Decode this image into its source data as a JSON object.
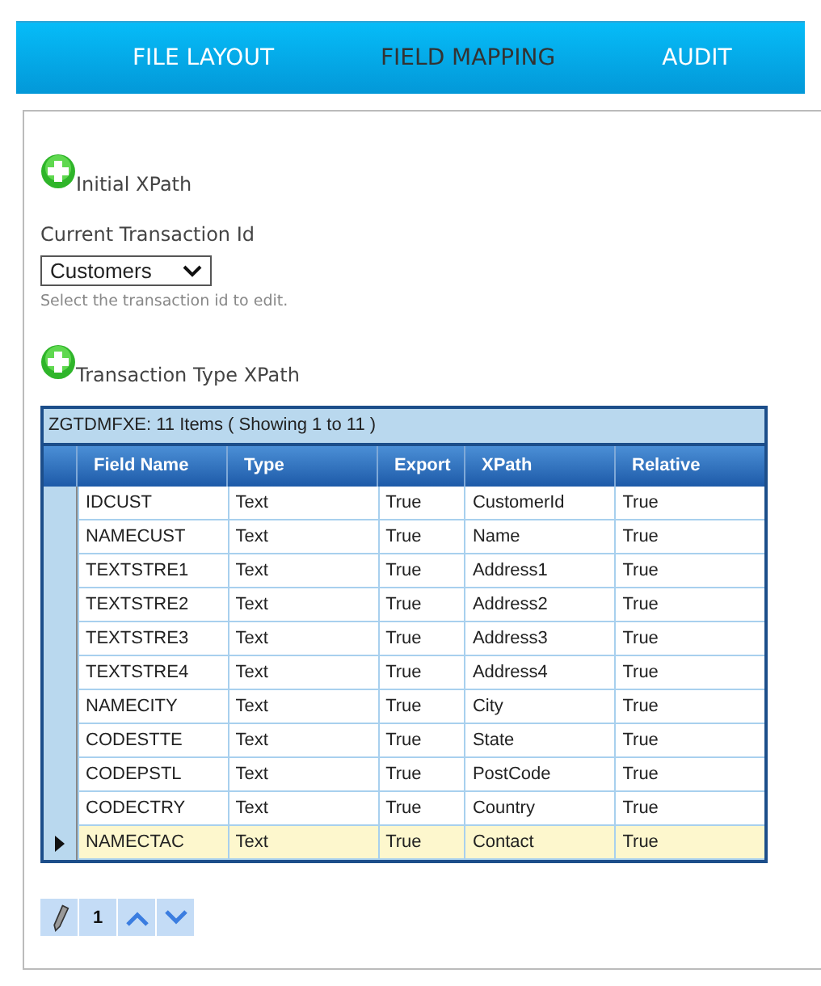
{
  "tabs": [
    {
      "label": "FILE LAYOUT",
      "selected": false
    },
    {
      "label": "FIELD MAPPING",
      "selected": true
    },
    {
      "label": "AUDIT",
      "selected": false
    }
  ],
  "initial_xpath": {
    "label": "Initial XPath"
  },
  "transaction": {
    "label": "Current Transaction Id",
    "value": "Customers",
    "hint": "Select the transaction id to edit."
  },
  "transaction_type_xpath": {
    "label": "Transaction Type XPath"
  },
  "grid": {
    "caption": "ZGTDMFXE: 11 Items ( Showing 1 to 11 )",
    "columns": [
      "Field Name",
      "Type",
      "Export",
      "XPath",
      "Relative"
    ],
    "rows": [
      {
        "cells": [
          "IDCUST",
          "Text",
          "True",
          "CustomerId",
          "True"
        ],
        "selected": false
      },
      {
        "cells": [
          "NAMECUST",
          "Text",
          "True",
          "Name",
          "True"
        ],
        "selected": false
      },
      {
        "cells": [
          "TEXTSTRE1",
          "Text",
          "True",
          "Address1",
          "True"
        ],
        "selected": false
      },
      {
        "cells": [
          "TEXTSTRE2",
          "Text",
          "True",
          "Address2",
          "True"
        ],
        "selected": false
      },
      {
        "cells": [
          "TEXTSTRE3",
          "Text",
          "True",
          "Address3",
          "True"
        ],
        "selected": false
      },
      {
        "cells": [
          "TEXTSTRE4",
          "Text",
          "True",
          "Address4",
          "True"
        ],
        "selected": false
      },
      {
        "cells": [
          "NAMECITY",
          "Text",
          "True",
          "City",
          "True"
        ],
        "selected": false
      },
      {
        "cells": [
          "CODESTTE",
          "Text",
          "True",
          "State",
          "True"
        ],
        "selected": false
      },
      {
        "cells": [
          "CODEPSTL",
          "Text",
          "True",
          "PostCode",
          "True"
        ],
        "selected": false
      },
      {
        "cells": [
          "CODECTRY",
          "Text",
          "True",
          "Country",
          "True"
        ],
        "selected": false
      },
      {
        "cells": [
          "NAMECTAC",
          "Text",
          "True",
          "Contact",
          "True"
        ],
        "selected": true
      }
    ]
  },
  "pager": {
    "page": "1"
  }
}
